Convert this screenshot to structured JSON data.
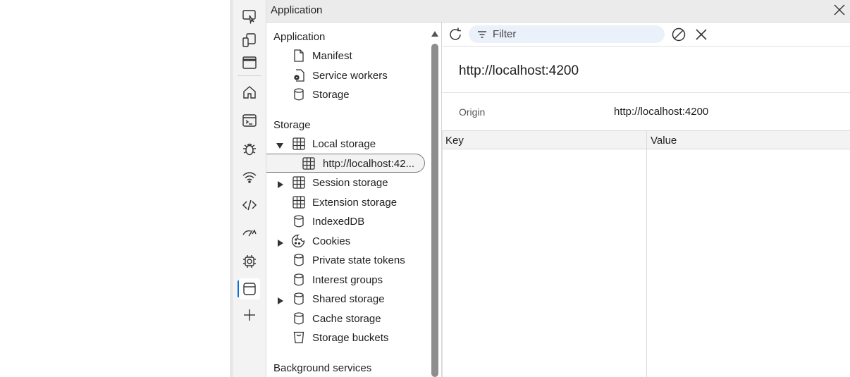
{
  "panel": {
    "title": "Application"
  },
  "sidebar": {
    "section_application": "Application",
    "application_items": [
      {
        "label": "Manifest",
        "icon": "file-icon"
      },
      {
        "label": "Service workers",
        "icon": "gear-file-icon"
      },
      {
        "label": "Storage",
        "icon": "database-icon"
      }
    ],
    "section_storage": "Storage",
    "storage_items": [
      {
        "label": "Local storage",
        "icon": "table-icon",
        "expanded": true
      },
      {
        "label": "http://localhost:42...",
        "icon": "table-icon",
        "selected": true
      },
      {
        "label": "Session storage",
        "icon": "table-icon",
        "expanded": false
      },
      {
        "label": "Extension storage",
        "icon": "table-icon"
      },
      {
        "label": "IndexedDB",
        "icon": "database-icon"
      },
      {
        "label": "Cookies",
        "icon": "cookie-icon",
        "expanded": false
      },
      {
        "label": "Private state tokens",
        "icon": "database-icon"
      },
      {
        "label": "Interest groups",
        "icon": "database-icon"
      },
      {
        "label": "Shared storage",
        "icon": "database-icon",
        "expanded": false
      },
      {
        "label": "Cache storage",
        "icon": "database-icon"
      },
      {
        "label": "Storage buckets",
        "icon": "bucket-icon"
      }
    ],
    "section_background": "Background services"
  },
  "toolbar": {
    "filter_placeholder": "Filter"
  },
  "main": {
    "origin_title": "http://localhost:4200",
    "origin_label": "Origin",
    "origin_value": "http://localhost:4200",
    "columns": [
      "Key",
      "Value"
    ]
  },
  "colors": {
    "accent": "#0b6fd6",
    "filter_bg": "#eaf1fb"
  }
}
